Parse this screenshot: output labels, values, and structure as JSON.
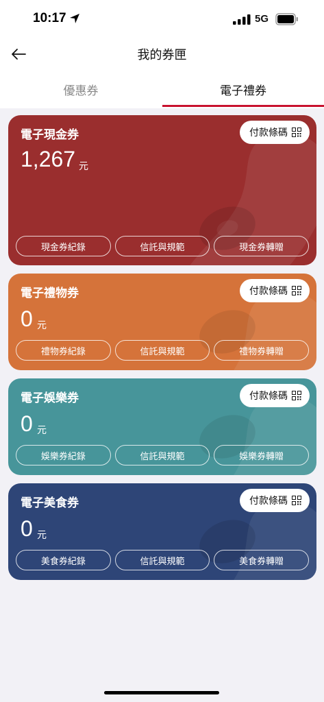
{
  "status": {
    "time": "10:17",
    "network": "5G"
  },
  "nav": {
    "title": "我的券匣"
  },
  "tabs": [
    {
      "label": "優惠券",
      "active": false
    },
    {
      "label": "電子禮券",
      "active": true
    }
  ],
  "accent_color": "#c8102e",
  "cards": [
    {
      "title": "電子現金券",
      "pay_label": "付款條碼",
      "amount": "1,267",
      "unit": "元",
      "color": "#9a2e2e",
      "actions": [
        "現金券紀錄",
        "信託與規範",
        "現金券轉贈"
      ]
    },
    {
      "title": "電子禮物券",
      "pay_label": "付款條碼",
      "amount": "0",
      "unit": "元",
      "color": "#d5733a",
      "actions": [
        "禮物券紀錄",
        "信託與規範",
        "禮物券轉贈"
      ]
    },
    {
      "title": "電子娛樂券",
      "pay_label": "付款條碼",
      "amount": "0",
      "unit": "元",
      "color": "#47959a",
      "actions": [
        "娛樂券紀錄",
        "信託與規範",
        "娛樂券轉贈"
      ]
    },
    {
      "title": "電子美食券",
      "pay_label": "付款條碼",
      "amount": "0",
      "unit": "元",
      "color": "#2e4577",
      "actions": [
        "美食券紀錄",
        "信託與規範",
        "美食券轉贈"
      ]
    }
  ]
}
